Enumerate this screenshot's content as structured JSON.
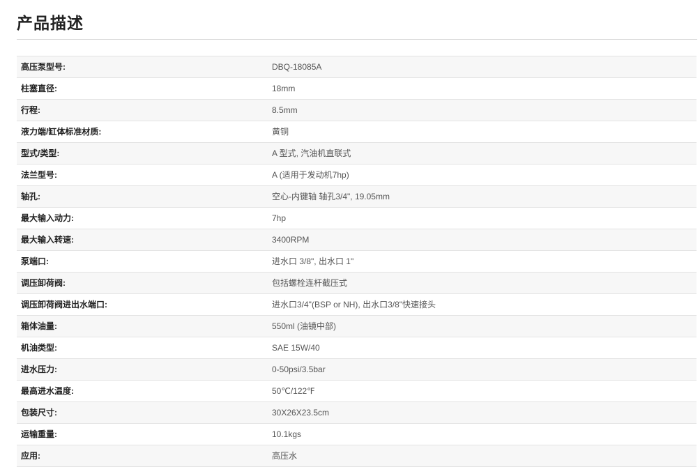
{
  "page": {
    "title": "产品描述"
  },
  "specs": [
    {
      "label": "高压泵型号:",
      "value": "DBQ-18085A"
    },
    {
      "label": "柱塞直径:",
      "value": "18mm"
    },
    {
      "label": "行程:",
      "value": "8.5mm"
    },
    {
      "label": "液力端/缸体标准材质:",
      "value": "黄铜"
    },
    {
      "label": "型式/类型:",
      "value": "A  型式, 汽油机直联式"
    },
    {
      "label": "法兰型号:",
      "value": "A  (适用于发动机7hp)"
    },
    {
      "label": "轴孔:",
      "value": "空心-内键轴  轴孔3/4\", 19.05mm"
    },
    {
      "label": "最大输入动力:",
      "value": "7hp"
    },
    {
      "label": "最大输入转速:",
      "value": "3400RPM"
    },
    {
      "label": "泵端口:",
      "value": "进水口 3/8\", 出水口 1\""
    },
    {
      "label": "调压卸荷阀:",
      "value": "包括螺栓连杆截压式"
    },
    {
      "label": "调压卸荷阀进出水端口:",
      "value": "进水口3/4\"(BSP or NH), 出水口3/8\"快速接头"
    },
    {
      "label": "箱体油量:",
      "value": "550ml (油镜中部)"
    },
    {
      "label": "机油类型:",
      "value": "SAE 15W/40"
    },
    {
      "label": "进水压力:",
      "value": "0-50psi/3.5bar"
    },
    {
      "label": "最高进水温度:",
      "value": "50℃/122℉"
    },
    {
      "label": "包装尺寸:",
      "value": "30X26X23.5cm"
    },
    {
      "label": "运输重量:",
      "value": "10.1kgs"
    },
    {
      "label": "应用:",
      "value": "高压水"
    }
  ]
}
